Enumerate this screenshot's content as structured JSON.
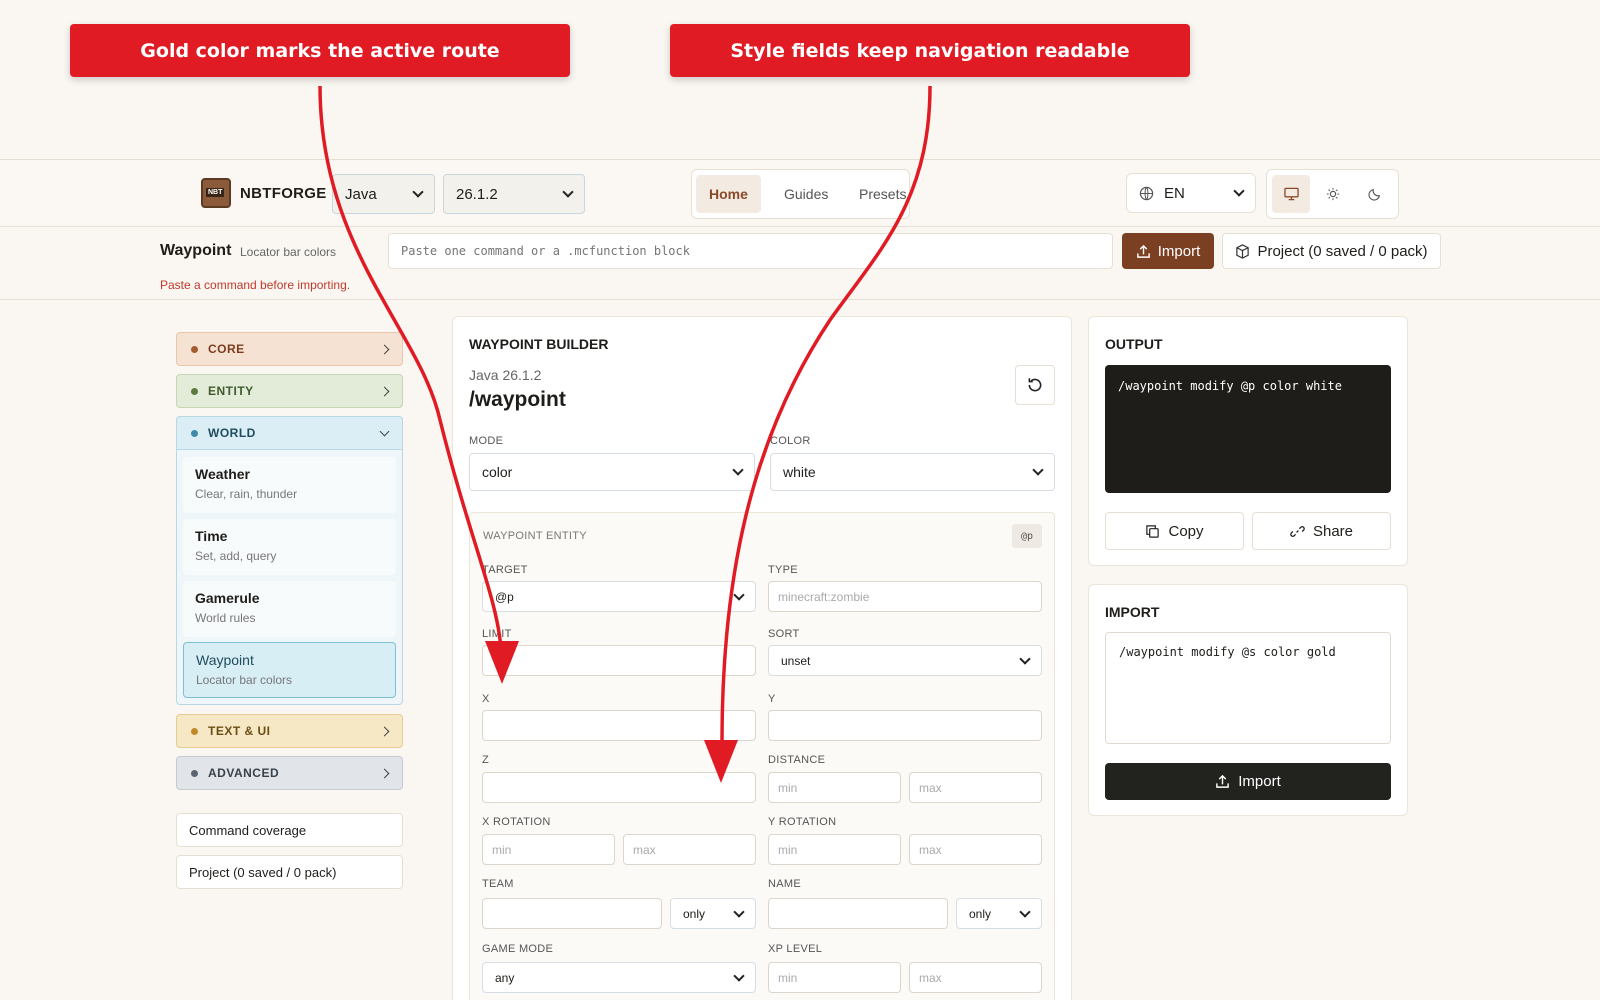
{
  "annotations": {
    "left": "Gold color marks the active route",
    "right": "Style fields keep navigation readable"
  },
  "header": {
    "brand": "NBTFORGE",
    "logo_text": "NBT",
    "edition": "Java",
    "version": "26.1.2",
    "tabs": [
      "Home",
      "Guides",
      "Presets"
    ],
    "active_tab": "Home",
    "language": "EN"
  },
  "import_bar": {
    "title": "Waypoint",
    "subtitle": "Locator bar colors",
    "error": "Paste a command before importing.",
    "placeholder": "Paste one command or a .mcfunction block",
    "import_label": "Import",
    "project_label": "Project (0 saved / 0 pack)"
  },
  "sidebar": {
    "categories": {
      "core": "CORE",
      "entity": "ENTITY",
      "world": "WORLD",
      "text": "TEXT & UI",
      "advanced": "ADVANCED"
    },
    "world_items": [
      {
        "title": "Weather",
        "subtitle": "Clear, rain, thunder"
      },
      {
        "title": "Time",
        "subtitle": "Set, add, query"
      },
      {
        "title": "Gamerule",
        "subtitle": "World rules"
      },
      {
        "title": "Waypoint",
        "subtitle": "Locator bar colors"
      }
    ],
    "links": [
      "Command coverage",
      "Project (0 saved / 0 pack)"
    ]
  },
  "builder": {
    "title": "WAYPOINT BUILDER",
    "version": "Java 26.1.2",
    "command": "/waypoint",
    "mode_label": "MODE",
    "mode_value": "color",
    "color_label": "COLOR",
    "color_value": "white",
    "entity_section": "WAYPOINT ENTITY",
    "entity_badge": "@p",
    "target_label": "TARGET",
    "target_value": "@p",
    "type_label": "TYPE",
    "type_placeholder": "minecraft:zombie",
    "limit_label": "LIMIT",
    "sort_label": "SORT",
    "sort_value": "unset",
    "x_label": "X",
    "y_label": "Y",
    "z_label": "Z",
    "distance_label": "DISTANCE",
    "xrot_label": "X ROTATION",
    "yrot_label": "Y ROTATION",
    "team_label": "TEAM",
    "team_mode": "only",
    "name_label": "NAME",
    "name_mode": "only",
    "gamemode_label": "GAME MODE",
    "gamemode_value": "any",
    "xp_label": "XP LEVEL",
    "min_placeholder": "min",
    "max_placeholder": "max"
  },
  "output": {
    "title": "OUTPUT",
    "command": "/waypoint modify @p color white",
    "copy_label": "Copy",
    "share_label": "Share"
  },
  "import_panel": {
    "title": "IMPORT",
    "value": "/waypoint modify @s color gold",
    "button": "Import"
  },
  "colors": {
    "accent": "#7b4022",
    "annotation": "#e01b24",
    "world": "#3d8aa8"
  }
}
